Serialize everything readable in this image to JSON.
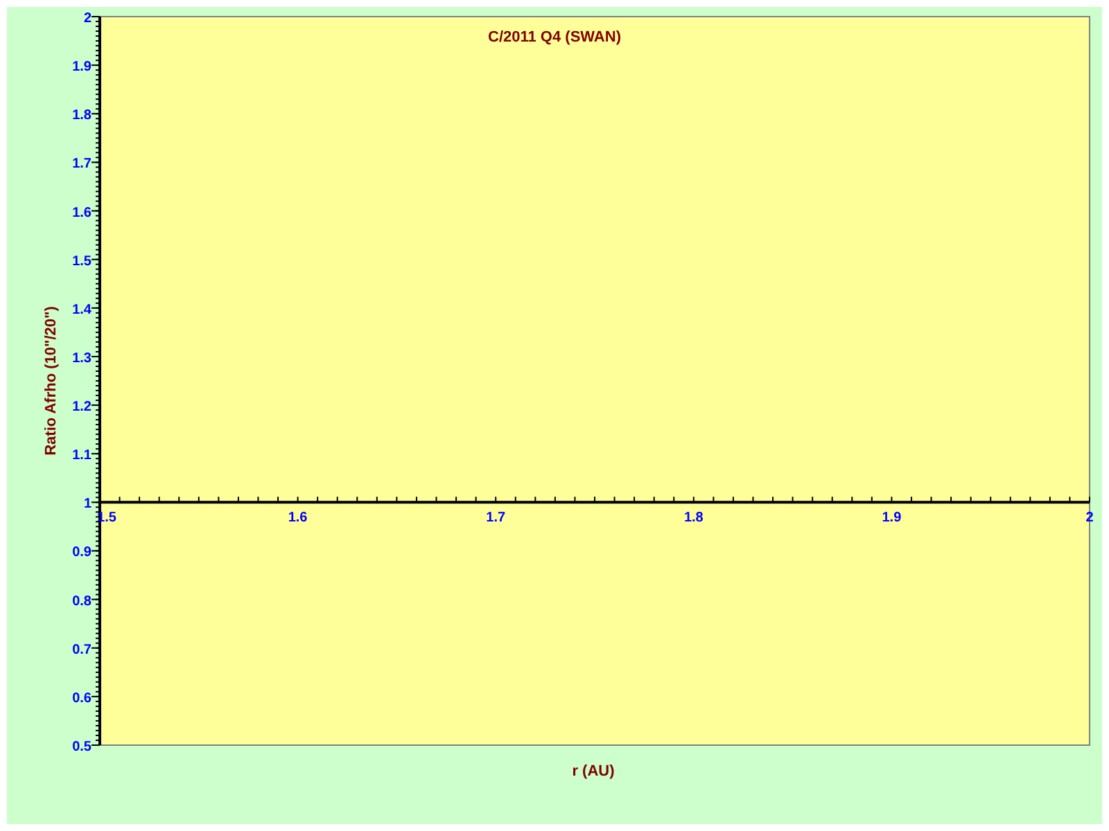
{
  "chart_data": {
    "type": "scatter",
    "title": "C/2011 Q4 (SWAN)",
    "xlabel": "r (AU)",
    "ylabel": "Ratio Afrho (10\"/20\")",
    "xlim": [
      1.5,
      2
    ],
    "ylim": [
      0.5,
      2
    ],
    "xticks": [
      {
        "value": 1.5,
        "label": "1.5"
      },
      {
        "value": 1.6,
        "label": "1.6"
      },
      {
        "value": 1.7,
        "label": "1.7"
      },
      {
        "value": 1.8,
        "label": "1.8"
      },
      {
        "value": 1.9,
        "label": "1.9"
      },
      {
        "value": 2,
        "label": "2"
      }
    ],
    "yticks": [
      {
        "value": 0.5,
        "label": "0.5"
      },
      {
        "value": 0.6,
        "label": "0.6"
      },
      {
        "value": 0.7,
        "label": "0.7"
      },
      {
        "value": 0.8,
        "label": "0.8"
      },
      {
        "value": 0.9,
        "label": "0.9"
      },
      {
        "value": 1,
        "label": "1"
      },
      {
        "value": 1.1,
        "label": "1.1"
      },
      {
        "value": 1.2,
        "label": "1.2"
      },
      {
        "value": 1.3,
        "label": "1.3"
      },
      {
        "value": 1.4,
        "label": "1.4"
      },
      {
        "value": 1.5,
        "label": "1.5"
      },
      {
        "value": 1.6,
        "label": "1.6"
      },
      {
        "value": 1.7,
        "label": "1.7"
      },
      {
        "value": 1.8,
        "label": "1.8"
      },
      {
        "value": 1.9,
        "label": "1.9"
      },
      {
        "value": 2,
        "label": "2"
      }
    ]
  }
}
